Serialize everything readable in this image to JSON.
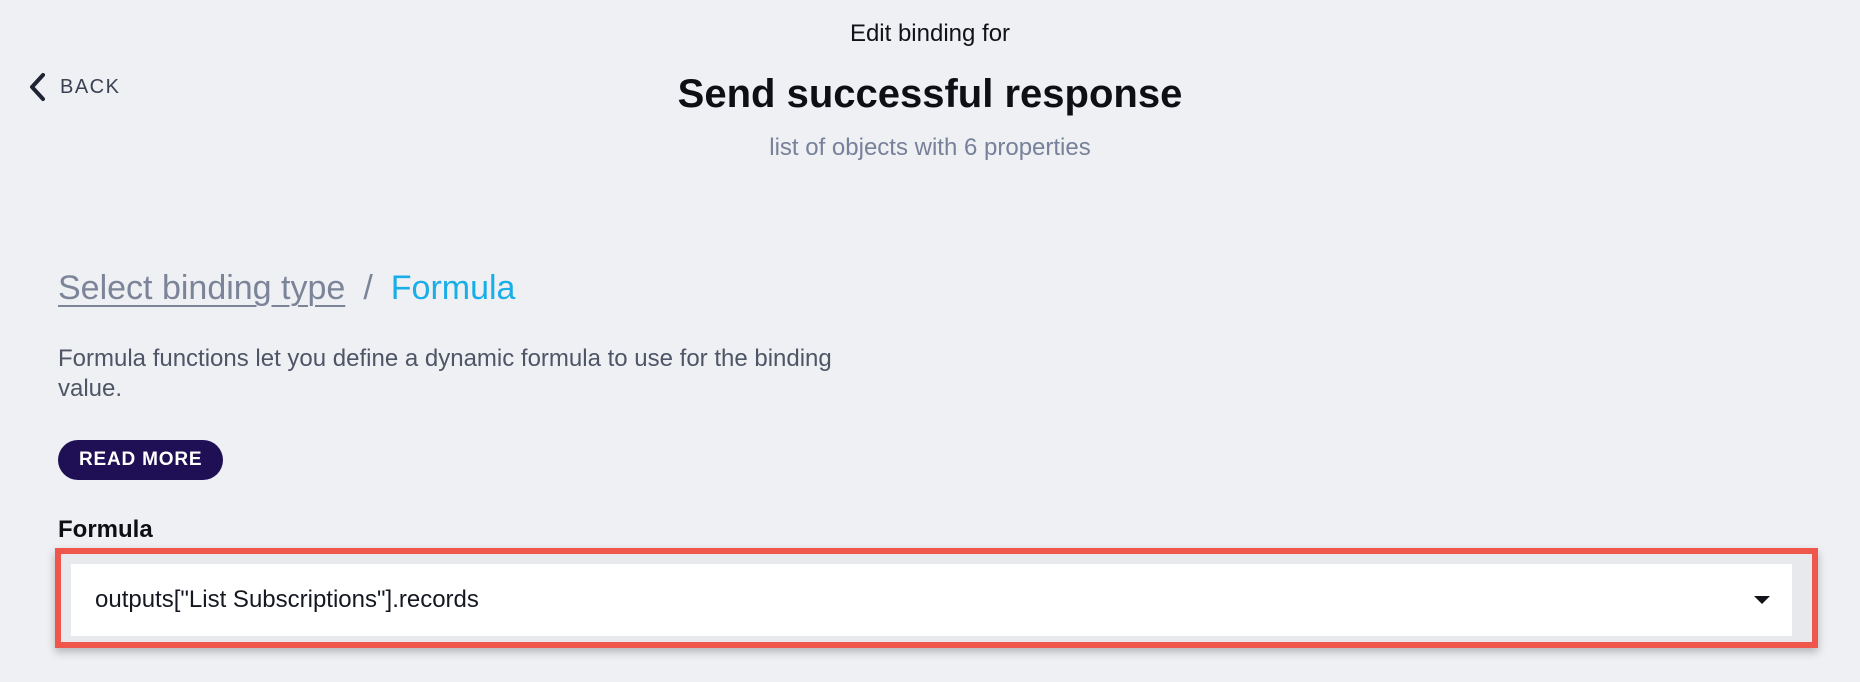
{
  "nav": {
    "back_label": "BACK"
  },
  "header": {
    "kicker": "Edit binding for",
    "title": "Send successful response",
    "subtitle": "list of objects with 6 properties"
  },
  "breadcrumb": {
    "link_label": "Select binding type",
    "separator": "/",
    "current": "Formula"
  },
  "description": "Formula functions let you define a dynamic formula to use for the binding value.",
  "read_more_label": "READ MORE",
  "formula": {
    "label": "Formula",
    "value": "outputs[\"List Subscriptions\"].records"
  },
  "icons": {
    "back": "chevron-left-icon",
    "dropdown": "caret-down-icon"
  },
  "colors": {
    "accent": "#19aee8",
    "button_bg": "#1f0f55",
    "highlight": "#f0574c"
  }
}
